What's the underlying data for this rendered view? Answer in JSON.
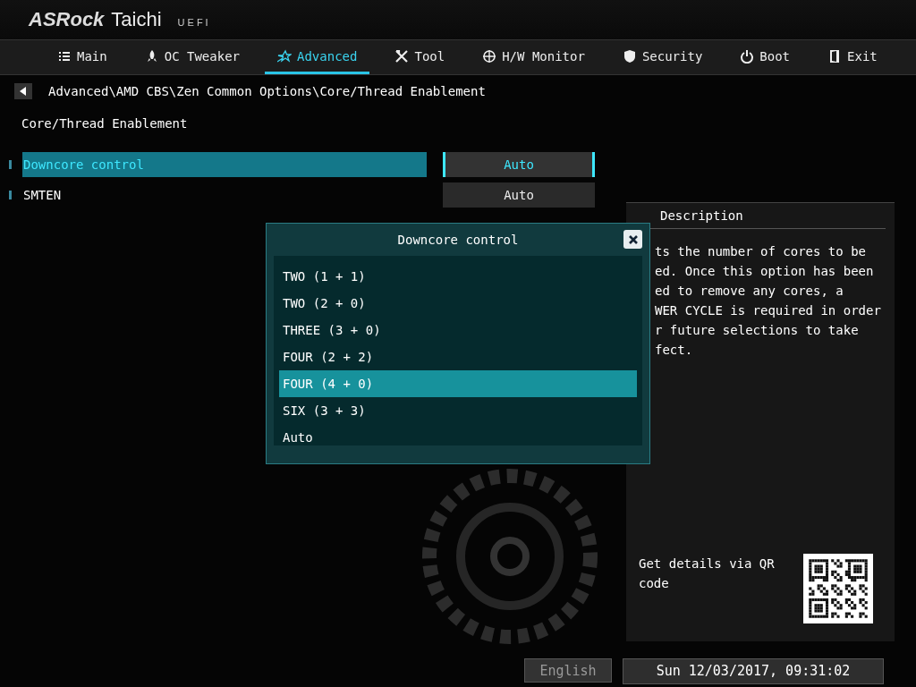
{
  "brand": {
    "logo": "ASRock",
    "product": "Taichi",
    "suffix": "UEFI"
  },
  "tabs": [
    {
      "label": "Main",
      "kind": "list",
      "selected": false
    },
    {
      "label": "OC Tweaker",
      "kind": "rocket",
      "selected": false
    },
    {
      "label": "Advanced",
      "kind": "star",
      "selected": true
    },
    {
      "label": "Tool",
      "kind": "tools",
      "selected": false
    },
    {
      "label": "H/W Monitor",
      "kind": "target",
      "selected": false
    },
    {
      "label": "Security",
      "kind": "shield",
      "selected": false
    },
    {
      "label": "Boot",
      "kind": "power",
      "selected": false
    },
    {
      "label": "Exit",
      "kind": "door",
      "selected": false
    }
  ],
  "breadcrumb": "Advanced\\AMD CBS\\Zen Common Options\\Core/Thread Enablement",
  "page_title": "Core/Thread Enablement",
  "settings": [
    {
      "label": "Downcore control",
      "value": "Auto",
      "selected": true
    },
    {
      "label": "SMTEN",
      "value": "Auto",
      "selected": false
    }
  ],
  "popup": {
    "title": "Downcore control",
    "options": [
      {
        "label": "TWO (1 + 1)",
        "selected": false
      },
      {
        "label": "TWO (2 + 0)",
        "selected": false
      },
      {
        "label": "THREE (3 + 0)",
        "selected": false
      },
      {
        "label": "FOUR (2 + 2)",
        "selected": false
      },
      {
        "label": "FOUR (4 + 0)",
        "selected": true
      },
      {
        "label": "SIX (3 + 3)",
        "selected": false
      },
      {
        "label": "Auto",
        "selected": false
      }
    ]
  },
  "description": {
    "title": "Description",
    "text": "ts the number of cores to be\ned. Once this option has been\ned to remove any cores, a\nWER CYCLE is required in order\nr future selections to take\nfect.",
    "qr_text": "Get details via QR code"
  },
  "status_bar": {
    "language": "English",
    "datetime": "Sun 12/03/2017, 09:31:02"
  }
}
